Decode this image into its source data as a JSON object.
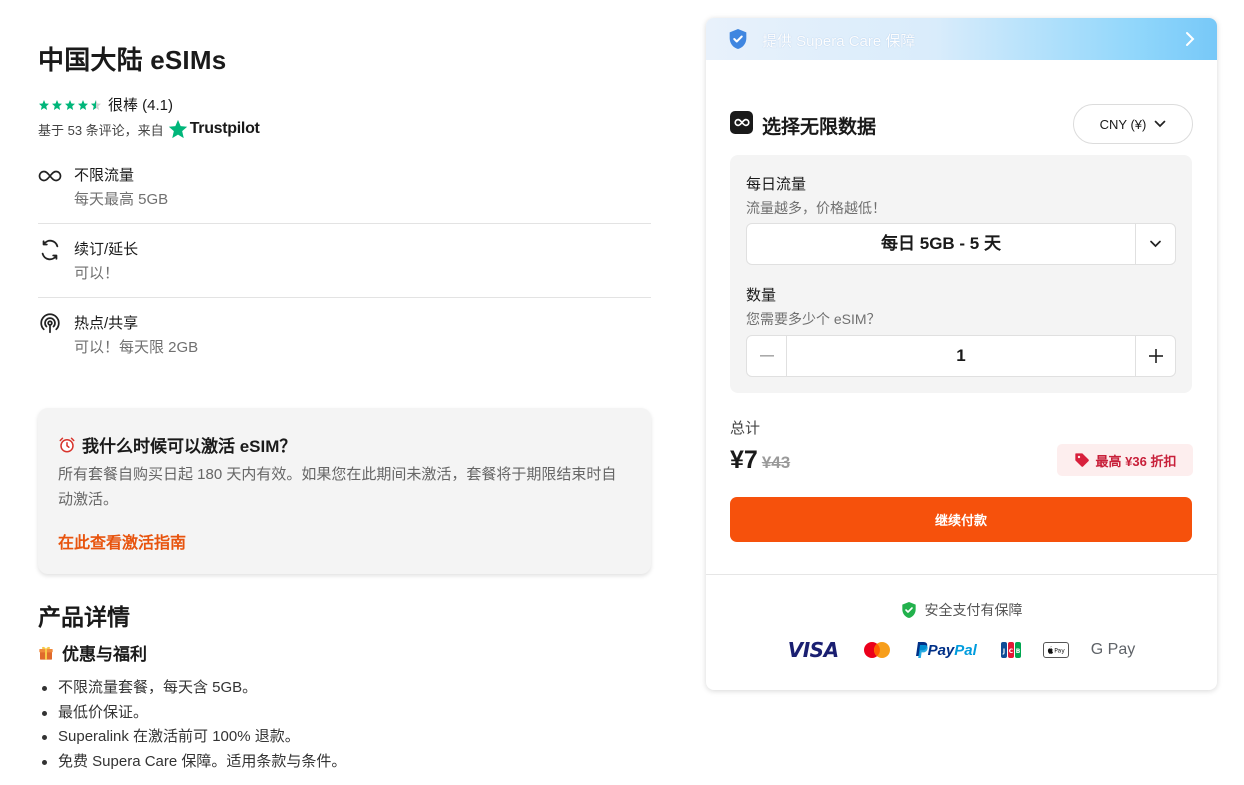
{
  "product": {
    "title": "中国大陆 eSIMs",
    "rating_label": "很棒 (4.1)",
    "rating_value": 4.1,
    "reviews_text": "基于 53 条评论，来自",
    "trustpilot": "Trustpilot"
  },
  "features": [
    {
      "icon": "infinity-icon",
      "title": "不限流量",
      "sub": "每天最高 5GB"
    },
    {
      "icon": "renew-icon",
      "title": "续订/延长",
      "sub": "可以！"
    },
    {
      "icon": "hotspot-icon",
      "title": "热点/共享",
      "sub": "可以！每天限 2GB"
    }
  ],
  "activation": {
    "title": "我什么时候可以激活 eSIM？",
    "body": "所有套餐自购买日起 180 天内有效。如果您在此期间未激活，套餐将于期限结束时自动激活。",
    "link": "在此查看激活指南"
  },
  "details": {
    "title": "产品详情",
    "benefits_title": "优惠与福利",
    "benefits": [
      "不限流量套餐，每天含 5GB。",
      "最低价保证。",
      "Superalink 在激活前可 100% 退款。",
      "免费 Supera Care 保障。适用条款与条件。"
    ]
  },
  "panel": {
    "care_banner": "提供 Supera Care 保障",
    "plan_title": "选择无限数据",
    "currency": "CNY (¥)",
    "daily_label": "每日流量",
    "daily_sub": "流量越多，价格越低！",
    "daily_value": "每日 5GB - 5 天",
    "qty_label": "数量",
    "qty_sub": "您需要多少个 eSIM？",
    "qty_value": "1",
    "qty_minus": "−",
    "qty_plus": "+",
    "total_label": "总计",
    "price_now": "¥7",
    "price_was": "¥43",
    "discount": "最高 ¥36 折扣",
    "pay_button": "继续付款",
    "secure_text": "安全支付有保障",
    "payments": {
      "visa": "VISA",
      "paypal_a": "Pay",
      "paypal_b": "Pal",
      "gpay": "G Pay"
    }
  },
  "colors": {
    "accent": "#f6510c",
    "link": "#e8540e",
    "star": "#00b67a",
    "discount_text": "#c8203a"
  }
}
